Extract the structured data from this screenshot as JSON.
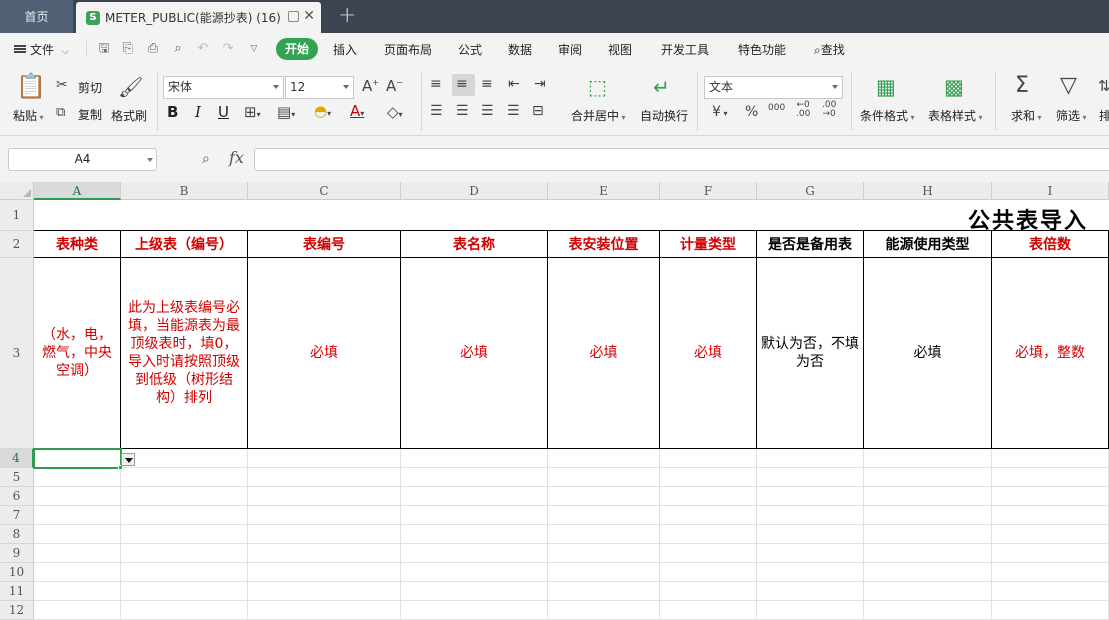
{
  "tabs": {
    "home": "首页",
    "doc": "METER_PUBLIC(能源抄表) (16)",
    "app_logo": "S"
  },
  "menu": {
    "file": "文件",
    "items": [
      "开始",
      "插入",
      "页面布局",
      "公式",
      "数据",
      "审阅",
      "视图",
      "开发工具",
      "特色功能",
      "查找"
    ]
  },
  "ribbon": {
    "paste": "粘贴",
    "cut": "剪切",
    "copy": "复制",
    "format_painter": "格式刷",
    "font_name": "宋体",
    "font_size": "12",
    "bold": "B",
    "italic": "I",
    "underline": "U",
    "merge_center": "合并居中",
    "wrap_text": "自动换行",
    "number_format": "文本",
    "currency": "¥",
    "percent": "%",
    "thousands": "000",
    "cond_format": "条件格式",
    "table_style": "表格样式",
    "sum": "求和",
    "filter": "筛选",
    "more": "排"
  },
  "formula_bar": {
    "name_box": "A4",
    "fx": "fx",
    "content": ""
  },
  "sheet": {
    "columns": [
      "A",
      "B",
      "C",
      "D",
      "E",
      "F",
      "G",
      "H",
      "I"
    ],
    "rows": [
      "1",
      "2",
      "3",
      "4",
      "5",
      "6",
      "7",
      "8",
      "9",
      "10",
      "11",
      "12"
    ],
    "title": "公共表导入",
    "headers": [
      "表种类",
      "上级表（编号）",
      "表编号",
      "表名称",
      "表安装位置",
      "计量类型",
      "是否是备用表",
      "能源使用类型",
      "表倍数"
    ],
    "notes": [
      "（水，电，燃气，中央空调）",
      "此为上级表编号必填，当能源表为最顶级表时，填0，导入时请按照顶级到低级（树形结构）排列",
      "必填",
      "必填",
      "必填",
      "必填",
      "默认为否，不填为否",
      "必填",
      "必填，整数"
    ],
    "selected_cell": "A4"
  },
  "colors": {
    "accent": "#31a352",
    "required": "#d10000",
    "tabbar": "#3c4452"
  }
}
